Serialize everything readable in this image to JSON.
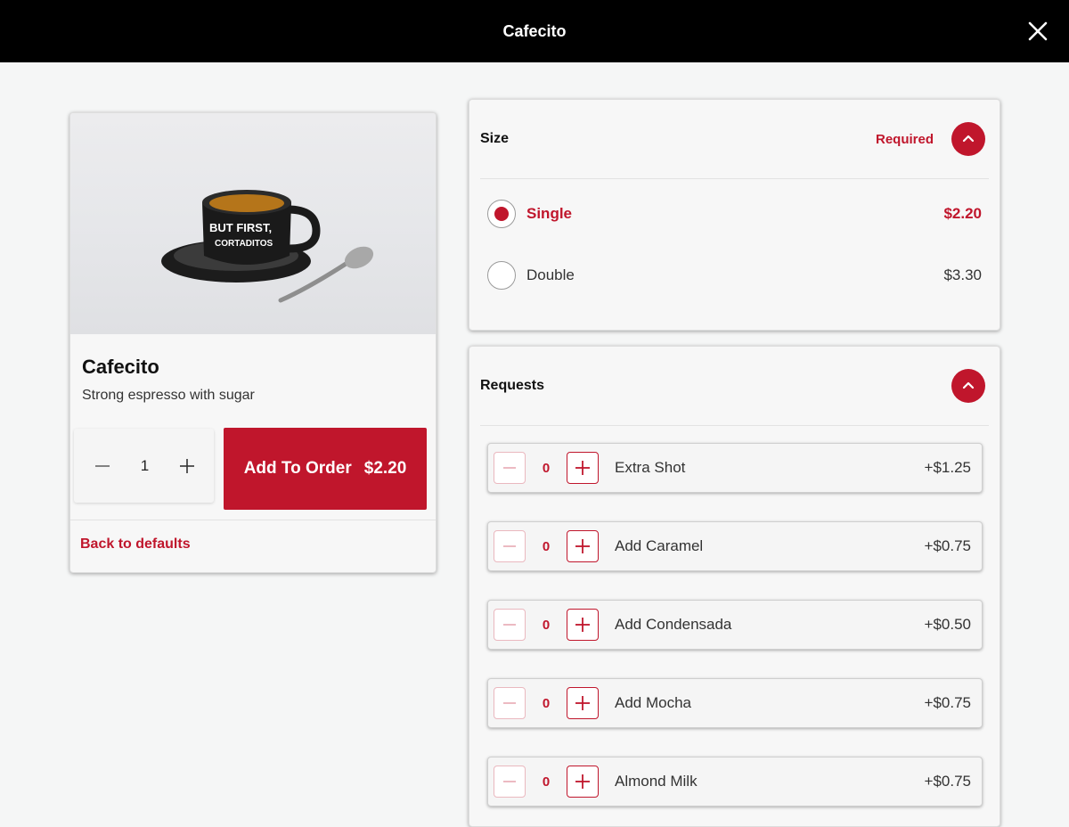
{
  "header": {
    "title": "Cafecito",
    "close_icon": "close-icon"
  },
  "product": {
    "name": "Cafecito",
    "description": "Strong espresso with sugar",
    "image_cup_text_line1": "BUT FIRST,",
    "image_cup_text_line2": "CORTADITOS",
    "quantity": "1",
    "add_button_label": "Add To Order",
    "add_button_price": "$2.20",
    "back_to_defaults": "Back to defaults"
  },
  "size_panel": {
    "title": "Size",
    "required_label": "Required",
    "options": [
      {
        "name": "Single",
        "price": "$2.20",
        "selected": true
      },
      {
        "name": "Double",
        "price": "$3.30",
        "selected": false
      }
    ]
  },
  "requests_panel": {
    "title": "Requests",
    "items": [
      {
        "name": "Extra Shot",
        "count": "0",
        "price": "+$1.25"
      },
      {
        "name": "Add Caramel",
        "count": "0",
        "price": "+$0.75"
      },
      {
        "name": "Add Condensada",
        "count": "0",
        "price": "+$0.50"
      },
      {
        "name": "Add Mocha",
        "count": "0",
        "price": "+$0.75"
      },
      {
        "name": "Almond Milk",
        "count": "0",
        "price": "+$0.75"
      }
    ]
  },
  "colors": {
    "accent": "#c0162c",
    "topbar": "#000000",
    "background": "#f5f6f6"
  }
}
